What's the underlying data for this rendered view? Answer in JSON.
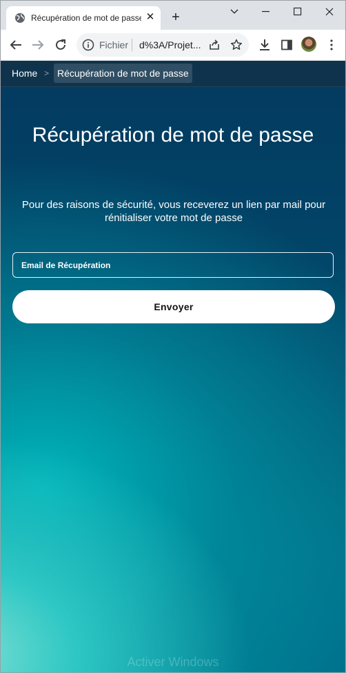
{
  "browser": {
    "tab": {
      "title": "Récupération de mot de passe",
      "favicon": "globe-icon"
    },
    "address": {
      "scheme": "Fichier",
      "url": "d%3A/Projet..."
    },
    "window_controls": [
      "minimize-icon",
      "maximize-icon",
      "close-icon"
    ]
  },
  "breadcrumb": {
    "home": "Home",
    "separator": ">",
    "current": "Récupération de mot de passe"
  },
  "page": {
    "title": "Récupération de mot de passe",
    "subtitle": "Pour des raisons de sécurité, vous receverez un lien par mail pour rénitialiser votre mot de passe",
    "email_placeholder": "Email de Récupération",
    "submit_label": "Envoyer"
  },
  "os_watermark": "Activer Windows",
  "colors": {
    "background_top": "#033a5e",
    "background_accent": "#00bac0",
    "button_bg": "#ffffff"
  }
}
